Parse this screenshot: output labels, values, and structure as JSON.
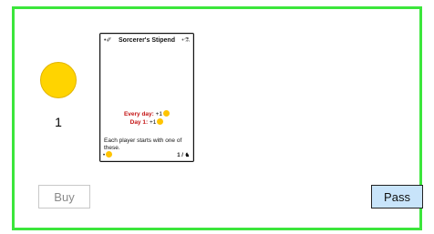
{
  "player": {
    "coin_count": "1"
  },
  "card": {
    "title": "Sorcerer's Stipend",
    "left_icon": "•✐",
    "right_icon": "•⚗",
    "effects": [
      {
        "label": "Every day:",
        "value": "+1"
      },
      {
        "label": "Day 1:",
        "value": "+1"
      }
    ],
    "description": "Each player starts with one of these.",
    "footer_left": "•",
    "footer_right": "1 / ♞"
  },
  "buttons": {
    "buy": "Buy",
    "pass": "Pass"
  },
  "colors": {
    "panel_border": "#3ce63c",
    "coin": "#ffd400",
    "effect_label": "#c41414",
    "pass_button_bg": "#c8e4fa"
  }
}
